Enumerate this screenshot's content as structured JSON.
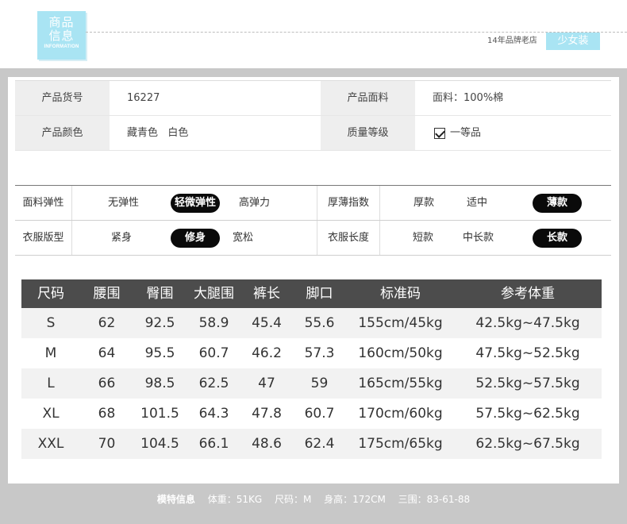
{
  "header": {
    "logo_line1": "商品",
    "logo_line2": "信息",
    "logo_line3": "INFORMATION",
    "brand_text": "14年品牌老店",
    "brand_tag": "少女装"
  },
  "info": {
    "rows": [
      {
        "label1": "产品货号",
        "value1": "16227",
        "label2": "产品面料",
        "value2": "面料：100%棉"
      },
      {
        "label1": "产品颜色",
        "value1": "藏青色   白色",
        "label2": "质量等级",
        "value2": "一等品"
      }
    ]
  },
  "attributes": {
    "rows": [
      {
        "label1": "面料弹性",
        "opts1": [
          "无弹性",
          "轻微弹性",
          "高弹力"
        ],
        "selected1": "轻微弹性",
        "label2": "厚薄指数",
        "opts2": [
          "厚款",
          "适中",
          "薄款"
        ],
        "selected2": "薄款"
      },
      {
        "label1": "衣服版型",
        "opts1": [
          "紧身",
          "修身",
          "宽松"
        ],
        "selected1": "修身",
        "label2": "衣服长度",
        "opts2": [
          "短款",
          "中长款",
          "长款"
        ],
        "selected2": "长款"
      }
    ]
  },
  "size_table": {
    "headers": [
      "尺码",
      "腰围",
      "臀围",
      "大腿围",
      "裤长",
      "脚口",
      "标准码",
      "参考体重"
    ],
    "rows": [
      [
        "S",
        "62",
        "92.5",
        "58.9",
        "45.4",
        "55.6",
        "155cm/45kg",
        "42.5kg~47.5kg"
      ],
      [
        "M",
        "64",
        "95.5",
        "60.7",
        "46.2",
        "57.3",
        "160cm/50kg",
        "47.5kg~52.5kg"
      ],
      [
        "L",
        "66",
        "98.5",
        "62.5",
        "47",
        "59",
        "165cm/55kg",
        "52.5kg~57.5kg"
      ],
      [
        "XL",
        "68",
        "101.5",
        "64.3",
        "47.8",
        "60.7",
        "170cm/60kg",
        "57.5kg~62.5kg"
      ],
      [
        "XXL",
        "70",
        "104.5",
        "66.1",
        "48.6",
        "62.4",
        "175cm/65kg",
        "62.5kg~67.5kg"
      ]
    ]
  },
  "footer": {
    "title": "模特信息",
    "weight": "体重：51KG",
    "size": "尺码：M",
    "height": "身高：172CM",
    "measurements": "三围：83-61-88"
  },
  "colors": {
    "accent": "#a9e4f3",
    "table_header": "#4c4c4c",
    "frame": "#c8c8c8",
    "pill": "#0a0a0a"
  }
}
